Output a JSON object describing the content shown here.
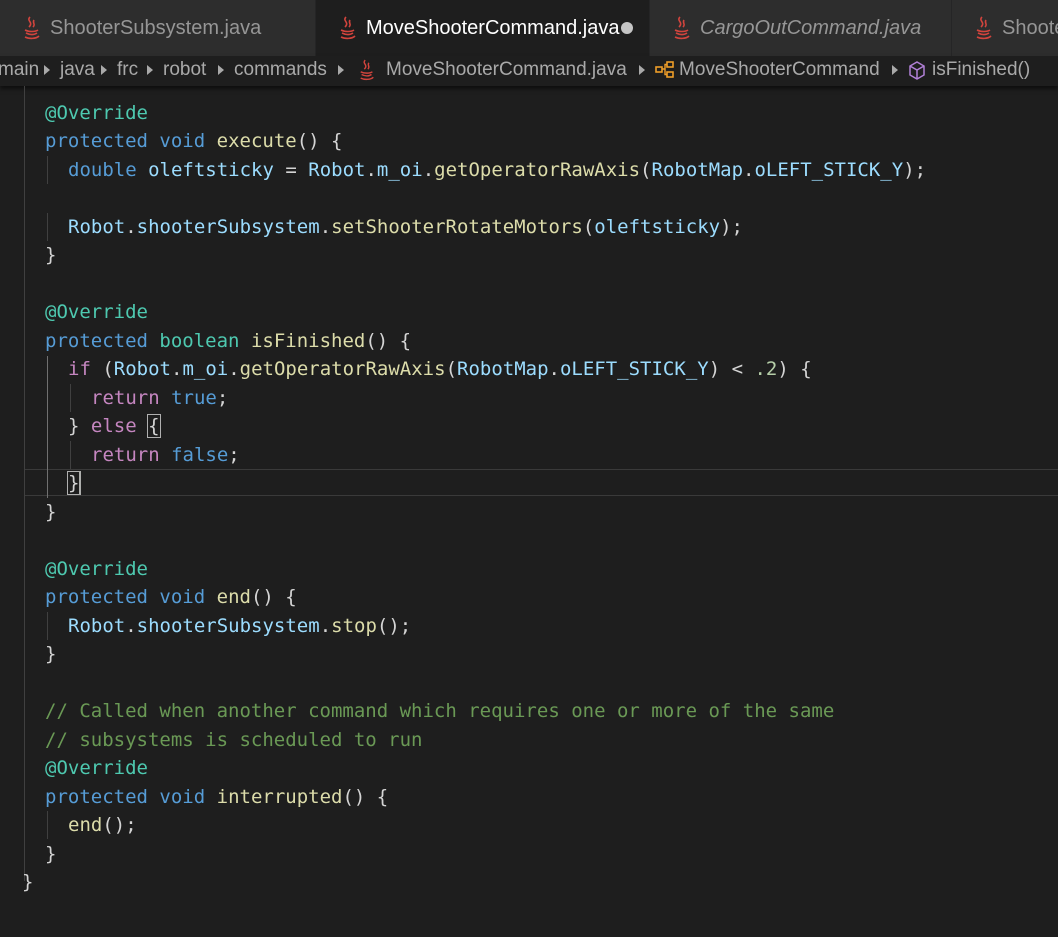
{
  "tabs": [
    {
      "label": "ShooterSubsystem.java",
      "icon": "java-icon",
      "active": false,
      "preview": false
    },
    {
      "label": "MoveShooterCommand.java",
      "icon": "java-icon",
      "active": true,
      "dirty": true
    },
    {
      "label": "CargoOutCommand.java",
      "icon": "java-icon",
      "active": false,
      "preview": true
    },
    {
      "label": "Shoote",
      "icon": "java-icon",
      "active": false,
      "preview": false
    }
  ],
  "breadcrumb": {
    "items": [
      "main",
      "java",
      "frc",
      "robot",
      "commands",
      "MoveShooterCommand.java",
      "MoveShooterCommand",
      "isFinished()"
    ],
    "icons": [
      "java-icon",
      "class-icon",
      "method-cube-icon"
    ]
  },
  "code": {
    "lines": [
      "@Override",
      "protected void execute() {",
      "double oleftsticky = Robot.m_oi.getOperatorRawAxis(RobotMap.oLEFT_STICK_Y);",
      "",
      "Robot.shooterSubsystem.setShooterRotateMotors(oleftsticky);",
      "}",
      "",
      "@Override",
      "protected boolean isFinished() {",
      "if (Robot.m_oi.getOperatorRawAxis(RobotMap.oLEFT_STICK_Y) < .2) {",
      "return true;",
      "} else {",
      "return false;",
      "}",
      "}",
      "",
      "@Override",
      "protected void end() {",
      "Robot.shooterSubsystem.stop();",
      "}",
      "",
      "// Called when another command which requires one or more of the same",
      "// subsystems is scheduled to run",
      "@Override",
      "protected void interrupted() {",
      "end();",
      "}",
      "}"
    ]
  },
  "colors": {
    "editor_bg": "#1e1e1e",
    "keyword": "#569cd6",
    "control": "#c586c0",
    "type": "#4ec9b0",
    "function": "#dcdcaa",
    "variable": "#9cdcfe",
    "number": "#b5cea8",
    "comment": "#6a9955",
    "java_icon": "#d2443d"
  }
}
